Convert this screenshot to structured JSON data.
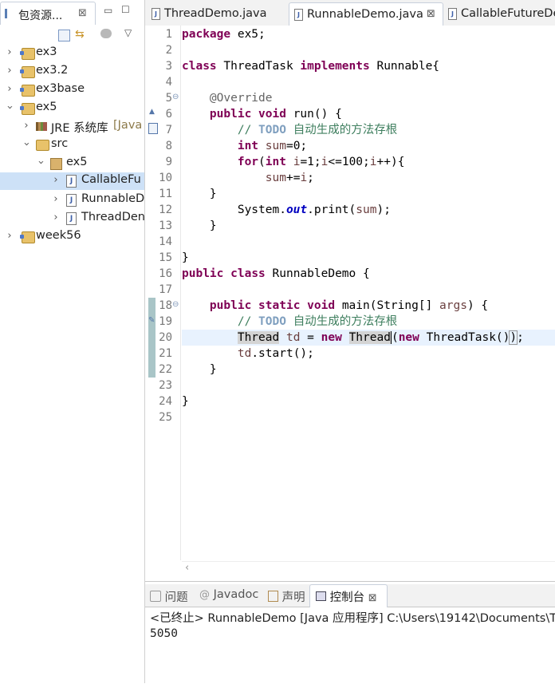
{
  "explorer": {
    "tab_label": "包资源...",
    "close": "⊠",
    "min": "▭",
    "max": "☐",
    "menu": "▽",
    "tree": [
      {
        "label": "ex3",
        "kind": "project",
        "expanded": false
      },
      {
        "label": "ex3.2",
        "kind": "project",
        "expanded": false
      },
      {
        "label": "ex3base",
        "kind": "project",
        "expanded": false
      },
      {
        "label": "ex5",
        "kind": "project",
        "expanded": true
      },
      {
        "label": "JRE 系统库",
        "suffix": "[Java",
        "kind": "library",
        "expanded": false
      },
      {
        "label": "src",
        "kind": "source-folder",
        "expanded": true
      },
      {
        "label": "ex5",
        "kind": "package",
        "expanded": true
      },
      {
        "label": "CallableFu",
        "kind": "java-file",
        "selected": true
      },
      {
        "label": "RunnableD",
        "kind": "java-file"
      },
      {
        "label": "ThreadDen",
        "kind": "java-file"
      },
      {
        "label": "week56",
        "kind": "project",
        "expanded": false
      }
    ]
  },
  "editor": {
    "tabs": [
      {
        "label": "ThreadDemo.java"
      },
      {
        "label": "RunnableDemo.java",
        "active": true
      },
      {
        "label": "CallableFutureDe"
      }
    ],
    "tab_close": "⊠",
    "line_numbers": [
      "1",
      "2",
      "3",
      "4",
      "5",
      "6",
      "7",
      "8",
      "9",
      "10",
      "11",
      "12",
      "13",
      "14",
      "15",
      "16",
      "17",
      "18",
      "19",
      "20",
      "21",
      "22",
      "23",
      "24",
      "25"
    ],
    "code": {
      "l1_kw": "package",
      "l1_rest": " ex5;",
      "l3_kw1": "class",
      "l3_a": " ThreadTask ",
      "l3_kw2": "implements",
      "l3_b": " Runnable{",
      "l5_ann": "@Override",
      "l6_kw1": "public",
      "l6_kw2": "void",
      "l6_rest": " run() {",
      "l7_cm1": "// ",
      "l7_todo": "TODO",
      "l7_cm2": " 自动生成的方法存根",
      "l8_kw": "int",
      "l8_var": " sum",
      "l8_rest": "=0;",
      "l9_kw1": "for",
      "l9_a": "(",
      "l9_kw2": "int",
      "l9_var1": " i",
      "l9_b": "=1;",
      "l9_var2": "i",
      "l9_c": "<=100;",
      "l9_var3": "i",
      "l9_d": "++){",
      "l10_var1": "sum",
      "l10_a": "+=",
      "l10_var2": "i",
      "l10_b": ";",
      "l11": "}",
      "l12_a": "System.",
      "l12_fld": "out",
      "l12_b": ".print(",
      "l12_var": "sum",
      "l12_c": ");",
      "l13": "}",
      "l15": "}",
      "l16_kw1": "public",
      "l16_kw2": "class",
      "l16_rest": " RunnableDemo {",
      "l18_kw1": "public",
      "l18_kw2": "static",
      "l18_kw3": "void",
      "l18_a": " main(String[] ",
      "l18_var": "args",
      "l18_b": ") {",
      "l19_cm1": "// ",
      "l19_todo": "TODO",
      "l19_cm2": " 自动生成的方法存根",
      "l20_occ1": "Thread",
      "l20_sp": " ",
      "l20_var": "td",
      "l20_a": " = ",
      "l20_kw1": "new",
      "l20_sp2": " ",
      "l20_occ2": "Thread",
      "l20_b": "(",
      "l20_kw2": "new",
      "l20_c": " ThreadTask()",
      "l20_d": ")",
      "l20_e": ";",
      "l21_var": "td",
      "l21_rest": ".start();",
      "l22": "}",
      "l24": "}"
    }
  },
  "console": {
    "tabs": [
      {
        "label": "问题"
      },
      {
        "label": "Javadoc"
      },
      {
        "label": "声明"
      },
      {
        "label": "控制台",
        "active": true
      }
    ],
    "tab_close": "⊠",
    "header": "<已终止> RunnableDemo [Java 应用程序] C:\\Users\\19142\\Documents\\T",
    "output": "5050"
  }
}
